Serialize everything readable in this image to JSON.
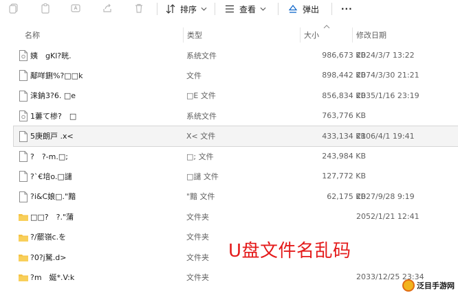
{
  "toolbar": {
    "sort_label": "排序",
    "view_label": "查看",
    "eject_label": "弹出",
    "more_label": "···"
  },
  "columns": {
    "name": "名称",
    "type": "类型",
    "size": "大小",
    "modified": "修改日期"
  },
  "files": [
    {
      "name": "姨　gKl?晄.",
      "type": "系统文件",
      "size": "986,673 KB",
      "date": "2024/3/7 13:22",
      "kind": "sys"
    },
    {
      "name": "鄅咩鉶%?□□k",
      "type": "文件",
      "size": "898,442 KB",
      "date": "2074/3/30 21:21",
      "kind": "file"
    },
    {
      "name": "涞鈉3?6. □e",
      "type": "□E 文件",
      "size": "856,834 KB",
      "date": "2035/1/16 23:19",
      "kind": "file"
    },
    {
      "name": "1蔞て椮?　□",
      "type": "系统文件",
      "size": "763,776 KB",
      "date": "",
      "kind": "sys"
    },
    {
      "name": "5庚朗戸 .x<",
      "type": "X< 文件",
      "size": "433,134 KB",
      "date": "2106/4/1 19:41",
      "kind": "file",
      "selected": true
    },
    {
      "name": "?　?-m.□;",
      "type": "□; 文件",
      "size": "243,984 KB",
      "date": "",
      "kind": "file"
    },
    {
      "name": " ?`€培o.□譴",
      "type": "□譴 文件",
      "size": "127,772 KB",
      "date": "",
      "kind": "file"
    },
    {
      "name": "?i&C娘□.\"黯",
      "type": "\"黯 文件",
      "size": "62,175 KB",
      "date": "2027/9/28 9:19",
      "kind": "file"
    },
    {
      "name": "□□?　?.\"蒲",
      "type": "文件夹",
      "size": "",
      "date": "2052/1/21 12:41",
      "kind": "folder"
    },
    {
      "name": "?/罷嶺c.を",
      "type": "文件夹",
      "size": "",
      "date": "",
      "kind": "folder"
    },
    {
      "name": "?0?j駑.d>",
      "type": "文件夹",
      "size": "",
      "date": "",
      "kind": "folder"
    },
    {
      "name": "?m　娫*.V:k",
      "type": "文件夹",
      "size": "",
      "date": "2033/12/25 23:34",
      "kind": "folder"
    }
  ],
  "overlay": {
    "caption": "U盘文件名乱码",
    "caption_color": "#e41a1a",
    "logo_text": "泛目手游网"
  },
  "colors": {
    "folder": "#f5c242",
    "selected_bg": "#f4f4f4",
    "accent": "#0a63c9"
  }
}
